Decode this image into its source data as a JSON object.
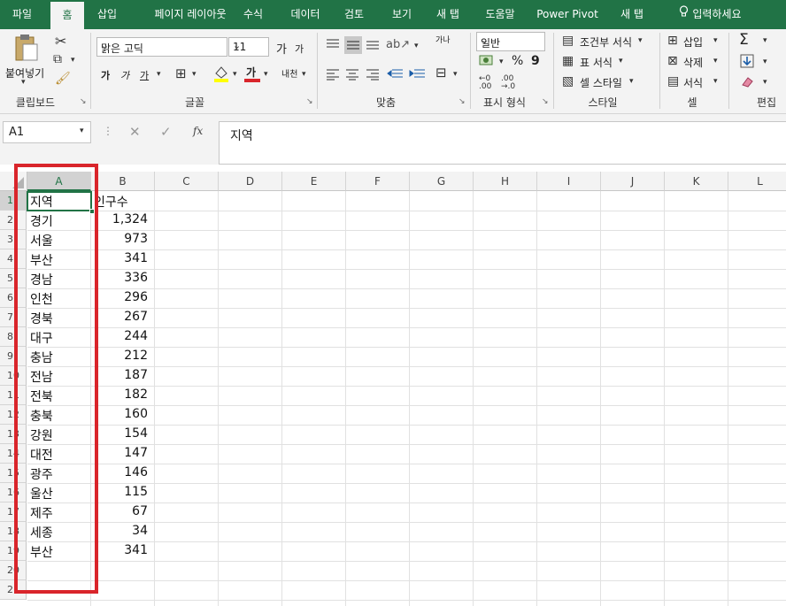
{
  "tabs": [
    "파일",
    "홈",
    "삽입",
    "페이지 레이아웃",
    "수식",
    "데이터",
    "검토",
    "보기",
    "새 탭",
    "도움말",
    "Power Pivot",
    "새 탭"
  ],
  "tell_me": "입력하세요",
  "ribbon": {
    "clipboard": {
      "label": "클립보드",
      "paste": "붙여넣기"
    },
    "font": {
      "label": "글꼴",
      "font_name": "맑은 고딕",
      "font_size": "11",
      "grow": "가",
      "shrink": "가",
      "bold": "가",
      "italic": "가",
      "underline": "가",
      "font_color_glyph": "가",
      "phonetic": "내천"
    },
    "alignment": {
      "label": "맞춤",
      "wrap": "가나"
    },
    "number": {
      "label": "표시 형식",
      "format": "일반",
      "percent": "%",
      "comma": "9"
    },
    "styles": {
      "label": "스타일",
      "conditional": "조건부 서식",
      "table": "표 서식",
      "cell_styles": "셀 스타일"
    },
    "cells": {
      "label": "셀",
      "insert": "삽입",
      "delete": "삭제",
      "format": "서식"
    },
    "editing": {
      "label": "편집",
      "sum": "Σ"
    }
  },
  "formula_bar": {
    "name_box": "A1",
    "fx": "fx",
    "content": "지역"
  },
  "columns": [
    "A",
    "B",
    "C",
    "D",
    "E",
    "F",
    "G",
    "H",
    "I",
    "J",
    "K",
    "L"
  ],
  "rows": [
    "1",
    "2",
    "3",
    "4",
    "5",
    "6",
    "7",
    "8",
    "9",
    "10",
    "11",
    "12",
    "13",
    "14",
    "15",
    "16",
    "17",
    "18",
    "19",
    "20",
    "21"
  ],
  "cells": [
    [
      "지역",
      "인구수"
    ],
    [
      "경기",
      "1,324"
    ],
    [
      "서울",
      "973"
    ],
    [
      "부산",
      "341"
    ],
    [
      "경남",
      "336"
    ],
    [
      "인천",
      "296"
    ],
    [
      "경북",
      "267"
    ],
    [
      "대구",
      "244"
    ],
    [
      "충남",
      "212"
    ],
    [
      "전남",
      "187"
    ],
    [
      "전북",
      "182"
    ],
    [
      "충북",
      "160"
    ],
    [
      "강원",
      "154"
    ],
    [
      "대전",
      "147"
    ],
    [
      "광주",
      "146"
    ],
    [
      "울산",
      "115"
    ],
    [
      "제주",
      "67"
    ],
    [
      "세종",
      "34"
    ],
    [
      "부산",
      "341"
    ]
  ],
  "colors": {
    "brand": "#217346",
    "highlight_box": "#d9252b",
    "font_color": "#d9252b",
    "fill_color": "#ffff00"
  }
}
